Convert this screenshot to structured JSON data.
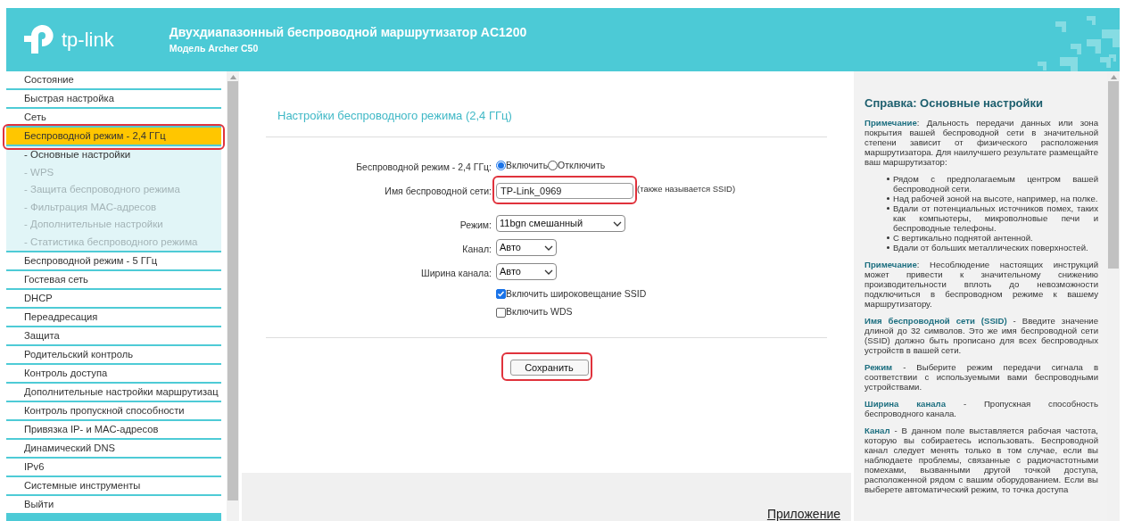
{
  "header": {
    "logo_text": "tp-link",
    "title": "Двухдиапазонный беспроводной маршрутизатор AC1200",
    "model": "Модель Archer C50"
  },
  "nav": [
    {
      "label": "Состояние",
      "selected": false,
      "highlighted": false
    },
    {
      "label": "Быстрая настройка",
      "selected": false,
      "highlighted": false
    },
    {
      "label": "Сеть",
      "selected": false,
      "highlighted": false
    },
    {
      "label": "Беспроводной режим - 2,4 ГГц",
      "selected": true,
      "highlighted": true,
      "children": [
        {
          "label": "- Основные настройки",
          "selected": true
        },
        {
          "label": "- WPS",
          "selected": false
        },
        {
          "label": "- Защита беспроводного режима",
          "selected": false
        },
        {
          "label": "- Фильтрация MAC-адресов",
          "selected": false
        },
        {
          "label": "- Дополнительные настройки",
          "selected": false
        },
        {
          "label": "- Статистика беспроводного режима",
          "selected": false
        }
      ]
    },
    {
      "label": "Беспроводной режим - 5 ГГц",
      "selected": false,
      "highlighted": false
    },
    {
      "label": "Гостевая сеть",
      "selected": false,
      "highlighted": false
    },
    {
      "label": "DHCP",
      "selected": false,
      "highlighted": false
    },
    {
      "label": "Переадресация",
      "selected": false,
      "highlighted": false
    },
    {
      "label": "Защита",
      "selected": false,
      "highlighted": false
    },
    {
      "label": "Родительский контроль",
      "selected": false,
      "highlighted": false
    },
    {
      "label": "Контроль доступа",
      "selected": false,
      "highlighted": false
    },
    {
      "label": "Дополнительные настройки маршрутизац",
      "selected": false,
      "highlighted": false
    },
    {
      "label": "Контроль пропускной способности",
      "selected": false,
      "highlighted": false
    },
    {
      "label": "Привязка IP- и MAC-адресов",
      "selected": false,
      "highlighted": false
    },
    {
      "label": "Динамический DNS",
      "selected": false,
      "highlighted": false
    },
    {
      "label": "IPv6",
      "selected": false,
      "highlighted": false
    },
    {
      "label": "Системные инструменты",
      "selected": false,
      "highlighted": false
    },
    {
      "label": "Выйти",
      "selected": false,
      "highlighted": false
    }
  ],
  "form": {
    "title": "Настройки беспроводного режима (2,4 ГГц)",
    "rows": [
      {
        "kind": "radio",
        "label": "Беспроводной режим - 2,4 ГГц:",
        "options": [
          {
            "label": "Включить",
            "selected": true
          },
          {
            "label": "Отключить",
            "selected": false
          }
        ]
      },
      {
        "kind": "text",
        "label": "Имя беспроводной сети:",
        "value": "TP-Link_0969",
        "note": "(также называется SSID)",
        "highlighted": true
      },
      {
        "kind": "select",
        "label": "Режим:",
        "value": "11bgn смешанный"
      },
      {
        "kind": "select",
        "label": "Канал:",
        "value": "Авто"
      },
      {
        "kind": "select",
        "label": "Ширина канала:",
        "value": "Авто"
      },
      {
        "kind": "checkbox",
        "label": "Включить широковещание SSID",
        "checked": true
      },
      {
        "kind": "checkbox",
        "label": "Включить WDS",
        "checked": false
      }
    ],
    "save_button": {
      "label": "Сохранить",
      "highlighted": true
    }
  },
  "footer_link": "Приложение",
  "help": {
    "title": "Справка: Основные настройки",
    "blocks": [
      {
        "kind": "paragraph",
        "text": "**Примечание**: Дальность передачи данных или зона покрытия вашей беспроводной сети в значительной степени зависит от физического расположения маршрутизатора. Для наилучшего результате размещайте ваш маршрутизатор:"
      },
      {
        "kind": "list",
        "items": [
          "Рядом с предполагаемым центром вашей беспроводной сети.",
          "Над рабочей зоной на высоте, например, на полке.",
          "Вдали от потенциальных источников помех, таких как компьютеры, микроволновые печи и беспроводные телефоны.",
          "С вертикально поднятой антенной.",
          "Вдали от больших металлических поверхностей."
        ]
      },
      {
        "kind": "paragraph",
        "text": "**Примечание**: Несоблюдение настоящих инструкций может привести к значительному снижению производительности вплоть до невозможности подключиться в беспроводном режиме к вашему маршрутизатору."
      },
      {
        "kind": "paragraph",
        "text": "**Имя беспроводной сети (SSID)** - Введите значение длиной до 32 символов. Это же имя беспроводной сети (SSID) должно быть прописано для всех беспроводных устройств в вашей сети."
      },
      {
        "kind": "paragraph",
        "text": "**Режим** - Выберите режим передачи сигнала в соответствии с используемыми вами беспроводными устройствами."
      },
      {
        "kind": "paragraph",
        "text": "**Ширина канала** - Пропускная способность беспроводного канала."
      },
      {
        "kind": "paragraph",
        "text": "**Канал** - В данном поле выставляется рабочая частота, которую вы собираетесь использовать. Беспроводной канал следует менять только в том случае, если вы наблюдаете проблемы, связанные с радиочастотными помехами, вызванными другой точкой доступа, расположенной рядом с вашим оборудованием. Если вы выберете автоматический режим, то точка доступа"
      }
    ]
  }
}
